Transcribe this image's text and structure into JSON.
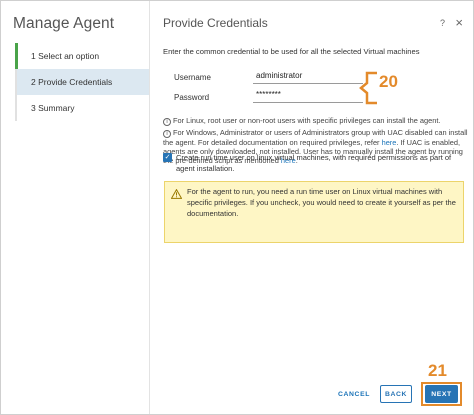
{
  "left": {
    "title": "Manage Agent",
    "steps": [
      {
        "label": "1  Select an option"
      },
      {
        "label": "2  Provide Credentials"
      },
      {
        "label": "3  Summary"
      }
    ]
  },
  "header": {
    "title": "Provide Credentials",
    "help_icon": "question-mark",
    "close_icon": "×"
  },
  "form": {
    "intro": "Enter the common credential to be used for all the selected Virtual machines",
    "username_label": "Username",
    "username_value": "administrator",
    "password_label": "Password",
    "password_value": "********"
  },
  "annotations": {
    "callout_20": "20",
    "callout_21": "21",
    "accent_color": "#e38a2b"
  },
  "notes": {
    "linux": "For Linux, root user or non-root users with specific privileges can install the agent.",
    "windows_prefix": "For Windows, Administrator or users of Administrators group with UAC disabled can install the agent. For detailed documentation on required privileges, refer ",
    "windows_link": "here",
    "windows_suffix": ". If UAC is enabled, agents are only downloaded, not installed. User has to manually install the agent by running the pre-defined script as mentioned ",
    "windows_link2": "here",
    "windows_end": "."
  },
  "checkbox": {
    "checked": true,
    "label": "Create run time user on linux virtual machines, with required permissions as part of agent installation."
  },
  "warning": {
    "text": "For the agent to run, you need a run time user on Linux virtual machines with specific privileges. If you uncheck, you would need to create it yourself as per the documentation."
  },
  "footer": {
    "cancel_label": "CANCEL",
    "back_label": "BACK",
    "next_label": "NEXT",
    "primary_color": "#2774b5"
  }
}
